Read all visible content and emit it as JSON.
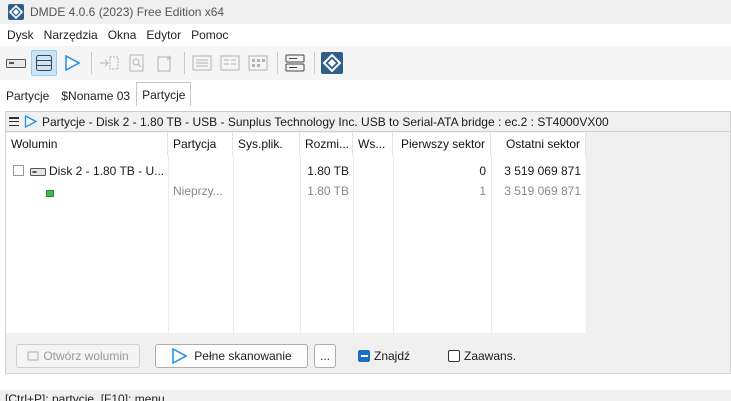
{
  "window": {
    "title": "DMDE 4.0.6 (2023) Free Edition x64"
  },
  "menu": [
    "Dysk",
    "Narzędzia",
    "Okna",
    "Edytor",
    "Pomoc"
  ],
  "tabs": [
    "Partycje",
    "$Noname 03",
    "Partycje"
  ],
  "panel": {
    "header": "Partycje - Disk 2 - 1.80 TB - USB - Sunplus Technology Inc. USB to Serial-ATA bridge : ec.2 : ST4000VX00"
  },
  "table": {
    "columns": [
      "Wolumin",
      "Partycja",
      "Sys.plik.",
      "Rozmi...",
      "Ws...",
      "Pierwszy sektor",
      "Ostatni sektor"
    ],
    "rows": [
      {
        "wolumin": "Disk 2 - 1.80 TB - U...",
        "partycja": "",
        "sysplik": "",
        "rozmiar": "1.80 TB",
        "ws": "",
        "pierwszy": "0",
        "ostatni": "3 519 069 871"
      },
      {
        "wolumin": "",
        "partycja": "Nieprzy...",
        "sysplik": "",
        "rozmiar": "1.80 TB",
        "ws": "",
        "pierwszy": "1",
        "ostatni": "3 519 069 871"
      }
    ]
  },
  "buttons": {
    "open_volume": "Otwórz wolumin",
    "full_scan": "Pełne skanowanie",
    "more": "..."
  },
  "checks": {
    "find": {
      "label": "Znajdź",
      "checked": true
    },
    "advanced": {
      "label": "Zaawans.",
      "checked": false
    }
  },
  "status": "[Ctrl+P]: partycje, [F10]: menu",
  "colors": {
    "accent": "#1f6fc5",
    "play": "#1e90e8",
    "selected_tool": "#cce4f7"
  }
}
